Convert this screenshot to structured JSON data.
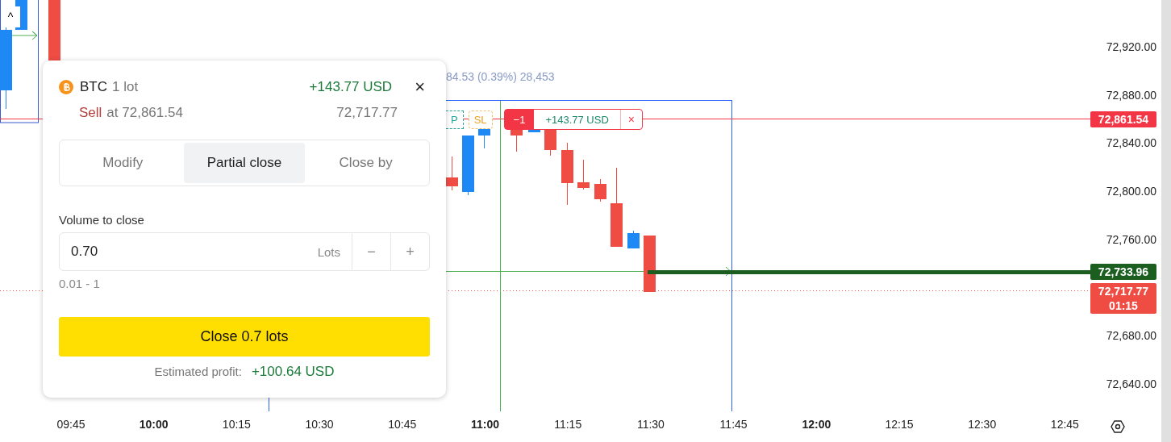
{
  "chart": {
    "legend": "84.53 (0.39%) 28,453",
    "collapse_button": "^",
    "order_tags": {
      "tp": "P",
      "sl": "SL",
      "quantity": "−1",
      "profit": "+143.77 USD",
      "close": "×"
    }
  },
  "price_axis": {
    "labels": [
      "72,920.00",
      "72,880.00",
      "72,840.00",
      "72,800.00",
      "72,760.00",
      "72,680.00",
      "72,640.00"
    ],
    "tags": [
      {
        "kind": "entry",
        "text": "72,861.54",
        "color": "#f23645"
      },
      {
        "kind": "target",
        "text": "72,733.96",
        "color": "#1b5e20"
      },
      {
        "kind": "last",
        "text": "72,717.77",
        "countdown": "01:15",
        "color": "#ef4c44"
      }
    ]
  },
  "time_axis": [
    {
      "label": "09:45",
      "major": false
    },
    {
      "label": "10:00",
      "major": true
    },
    {
      "label": "10:15",
      "major": false
    },
    {
      "label": "10:30",
      "major": false
    },
    {
      "label": "10:45",
      "major": false
    },
    {
      "label": "11:00",
      "major": true
    },
    {
      "label": "11:15",
      "major": false
    },
    {
      "label": "11:30",
      "major": false
    },
    {
      "label": "11:45",
      "major": false
    },
    {
      "label": "12:00",
      "major": true
    },
    {
      "label": "12:15",
      "major": false
    },
    {
      "label": "12:30",
      "major": false
    },
    {
      "label": "12:45",
      "major": false
    }
  ],
  "popup": {
    "symbol": "BTC",
    "size": "1 lot",
    "profit": "+143.77 USD",
    "close": "×",
    "side": "Sell",
    "open_price": "at 72,861.54",
    "current_price": "72,717.77",
    "tabs": [
      {
        "label": "Modify",
        "selected": false
      },
      {
        "label": "Partial close",
        "selected": true
      },
      {
        "label": "Close by",
        "selected": false
      }
    ],
    "volume_label": "Volume to close",
    "volume": "0.70",
    "unit": "Lots",
    "minus": "−",
    "plus": "+",
    "range": "0.01 - 1",
    "submit": "Close 0.7 lots",
    "estimate_label": "Estimated profit:",
    "estimate": "+100.64 USD"
  }
}
